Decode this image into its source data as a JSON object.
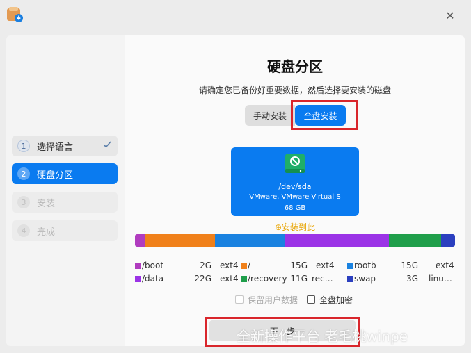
{
  "window": {
    "close_label": "✕"
  },
  "sidebar": {
    "steps": [
      {
        "num": "1",
        "label": "选择语言"
      },
      {
        "num": "2",
        "label": "硬盘分区"
      },
      {
        "num": "3",
        "label": "安装"
      },
      {
        "num": "4",
        "label": "完成"
      }
    ]
  },
  "main": {
    "title": "硬盘分区",
    "subtitle": "请确定您已备份好重要数据，然后选择要安装的磁盘",
    "mode_manual": "手动安装",
    "mode_full": "全盘安装",
    "disk": {
      "name": "/dev/sda",
      "model": "VMware, VMware Virtual S",
      "size": "68 GB"
    },
    "install_here": "⊕安装到此",
    "partitions": [
      {
        "name": "/boot",
        "size": "2G",
        "fs": "ext4",
        "color": "#b03cbf",
        "share": 2
      },
      {
        "name": "/",
        "size": "15G",
        "fs": "ext4",
        "color": "#f0801a",
        "share": 15
      },
      {
        "name": "rootb",
        "size": "15G",
        "fs": "ext4",
        "color": "#1a82e0",
        "share": 15
      },
      {
        "name": "/data",
        "size": "22G",
        "fs": "ext4",
        "color": "#9b33e6",
        "share": 22
      },
      {
        "name": "/recovery",
        "size": "11G",
        "fs": "rec…",
        "color": "#1f9e4a",
        "share": 11
      },
      {
        "name": "swap",
        "size": "3G",
        "fs": "linu…",
        "color": "#2b3fbf",
        "share": 3
      }
    ],
    "option_keep": "保留用户数据",
    "option_encrypt": "全盘加密",
    "next_label": "下一步"
  },
  "watermark": "全新操作平台 老毛桃winpe"
}
